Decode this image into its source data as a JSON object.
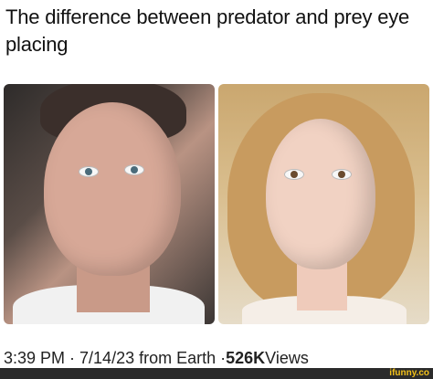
{
  "post": {
    "caption": "The difference between predator and prey eye placing",
    "timestamp": "3:39 PM · 7/14/23 from Earth · ",
    "views_count": "526K",
    "views_label": " Views"
  },
  "watermark": "ifunny.co"
}
